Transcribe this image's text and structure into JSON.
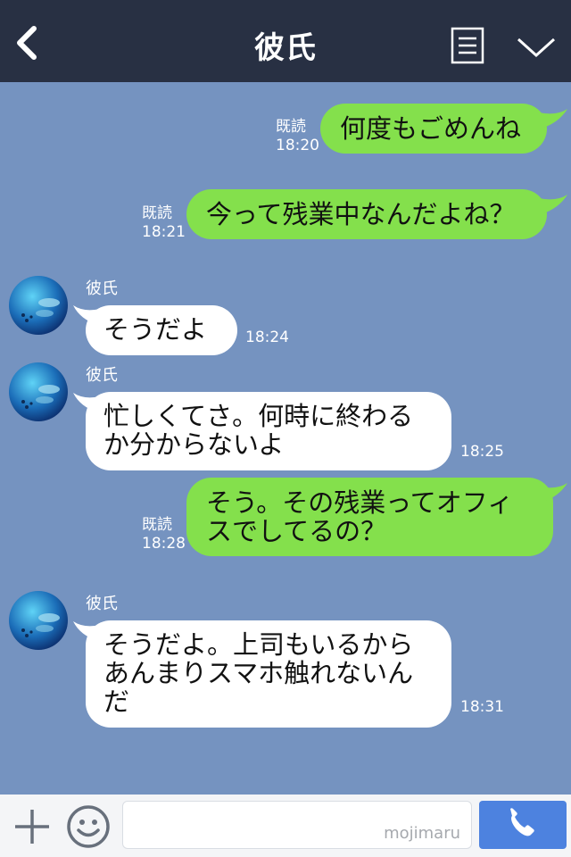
{
  "header": {
    "title": "彼氏",
    "icons": {
      "back": "chevron-left-icon",
      "menu": "list-icon",
      "expand": "chevron-down-icon"
    }
  },
  "colors": {
    "header_bg": "#283043",
    "chat_bg": "#7593c0",
    "my_bubble": "#84e04c",
    "their_bubble": "#ffffff",
    "send_button": "#4d82df"
  },
  "messages": [
    {
      "from": "me",
      "lines": [
        "何度もごめんね"
      ],
      "read_label": "既読",
      "time": "18:20"
    },
    {
      "from": "me",
      "lines": [
        "今って残業中なんだよね？"
      ],
      "read_label": "既読",
      "time": "18:21"
    },
    {
      "from": "them",
      "sender": "彼氏",
      "lines": [
        "そうだよ"
      ],
      "time": "18:24"
    },
    {
      "from": "them",
      "sender": "彼氏",
      "lines": [
        "忙しくてさ。何時に終わる",
        "か分からないよ"
      ],
      "time": "18:25"
    },
    {
      "from": "me",
      "lines": [
        "そう。その残業ってオフィ",
        "スでしてるの？"
      ],
      "read_label": "既読",
      "time": "18:28"
    },
    {
      "from": "them",
      "sender": "彼氏",
      "lines": [
        "そうだよ。上司もいるから",
        "あんまりスマホ触れないん",
        "だ"
      ],
      "time": "18:31"
    }
  ],
  "footer": {
    "input_value": "",
    "watermark": "mojimaru",
    "icons": {
      "plus": "plus-icon",
      "emoji": "smiley-icon",
      "call": "phone-icon"
    }
  }
}
